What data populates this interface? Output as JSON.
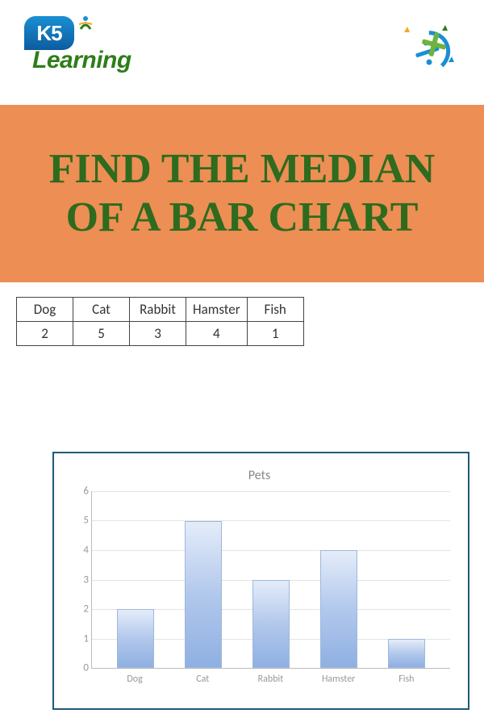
{
  "header": {
    "k5_text": "K5",
    "learning_text": "Learning"
  },
  "banner": {
    "title": "FIND THE MEDIAN OF A BAR CHART"
  },
  "table": {
    "headers": [
      "Dog",
      "Cat",
      "Rabbit",
      "Hamster",
      "Fish"
    ],
    "values": [
      "2",
      "5",
      "3",
      "4",
      "1"
    ]
  },
  "chart_data": {
    "type": "bar",
    "title": "Pets",
    "categories": [
      "Dog",
      "Cat",
      "Rabbit",
      "Hamster",
      "Fish"
    ],
    "values": [
      2,
      5,
      3,
      4,
      1
    ],
    "xlabel": "",
    "ylabel": "",
    "ylim": [
      0,
      6
    ],
    "yticks": [
      0,
      1,
      2,
      3,
      4,
      5,
      6
    ]
  }
}
